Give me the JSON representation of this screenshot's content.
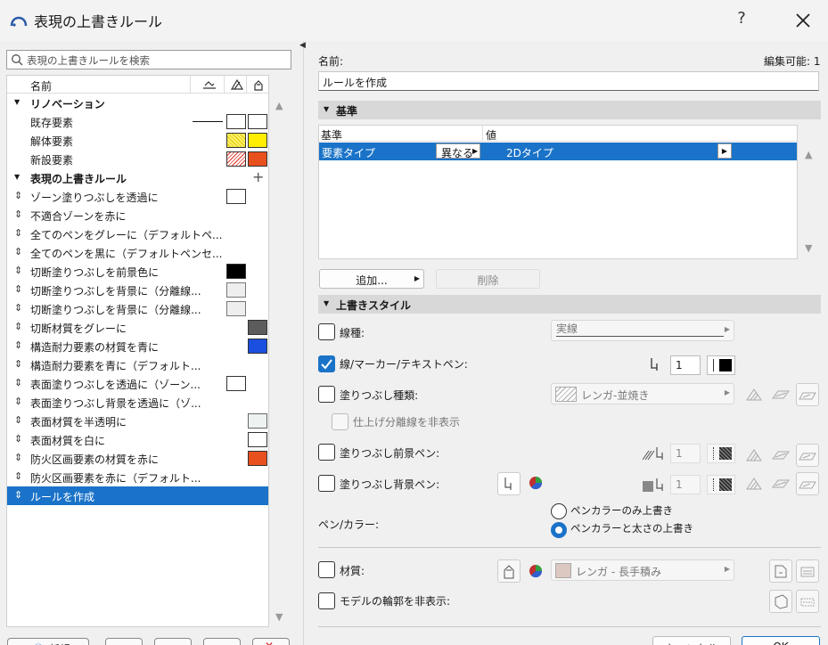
{
  "window": {
    "title": "表現の上書きルール",
    "help": "?",
    "edit_label": "編集可能: 1"
  },
  "left": {
    "search_placeholder": "表現の上書きルールを検索",
    "column_name": "名前",
    "rows": [
      {
        "kind": "group",
        "label": "リノベーション"
      },
      {
        "kind": "item",
        "label": "既存要素",
        "swatch": "line-white"
      },
      {
        "kind": "item",
        "label": "解体要素",
        "swatch": "yellow"
      },
      {
        "kind": "item",
        "label": "新設要素",
        "swatch": "red"
      },
      {
        "kind": "group",
        "label": "表現の上書きルール"
      },
      {
        "kind": "rule",
        "label": "ゾーン塗りつぶしを透過に",
        "swatch": "white-b"
      },
      {
        "kind": "rule",
        "label": "不適合ゾーンを赤に"
      },
      {
        "kind": "rule",
        "label": "全てのペンをグレーに（デフォルトペ..."
      },
      {
        "kind": "rule",
        "label": "全てのペンを黒に（デフォルトペンセ..."
      },
      {
        "kind": "rule",
        "label": "切断塗りつぶしを前景色に",
        "swatch": "black-b"
      },
      {
        "kind": "rule",
        "label": "切断塗りつぶしを背景に（分離線...",
        "swatch": "light-b"
      },
      {
        "kind": "rule",
        "label": "切断塗りつぶしを背景に（分離線...",
        "swatch": "light-b"
      },
      {
        "kind": "rule",
        "label": "切断材質をグレーに",
        "swatch": "gray-c"
      },
      {
        "kind": "rule",
        "label": "構造耐力要素の材質を青に",
        "swatch": "blue-c"
      },
      {
        "kind": "rule",
        "label": "構造耐力要素を青に（デフォルト..."
      },
      {
        "kind": "rule",
        "label": "表面塗りつぶしを透過に（ゾーン...",
        "swatch": "white-b"
      },
      {
        "kind": "rule",
        "label": "表面塗りつぶし背景を透過に（ゾ..."
      },
      {
        "kind": "rule",
        "label": "表面材質を半透明に",
        "swatch": "pale-c"
      },
      {
        "kind": "rule",
        "label": "表面材質を白に",
        "swatch": "white-c"
      },
      {
        "kind": "rule",
        "label": "防火区画要素の材質を赤に",
        "swatch": "orange-c"
      },
      {
        "kind": "rule",
        "label": "防火区画要素を赤に（デフォルト..."
      },
      {
        "kind": "rule",
        "label": "ルールを作成",
        "selected": true
      }
    ],
    "bottom_buttons": [
      "新規",
      "",
      "",
      "",
      ""
    ]
  },
  "right": {
    "name_label": "名前:",
    "name_value": "ルールを作成",
    "criteria_section": "基準",
    "crit_col1": "基準",
    "crit_col2": "値",
    "crit_row": {
      "criterion": "要素タイプ",
      "operator": "異なる",
      "value": "2Dタイプ"
    },
    "add_btn": "追加...",
    "delete_btn": "削除",
    "style_section": "上書きスタイル",
    "line_type_label": "線種:",
    "line_type_value": "実線",
    "pen_label": "線/マーカー/テキストペン:",
    "pen_value": "1",
    "fill_type_label": "塗りつぶし種類:",
    "fill_type_value": "レンガ-並焼き",
    "hide_sep_label": "仕上げ分離線を非表示",
    "fill_fg_label": "塗りつぶし前景ペン:",
    "fill_fg_value": "1",
    "fill_bg_label": "塗りつぶし背景ペン:",
    "fill_bg_value": "1",
    "pen_color_label": "ペン/カラー:",
    "radio1": "ペンカラーのみ上書き",
    "radio2": "ペンカラーと太さの上書き",
    "material_label": "材質:",
    "material_value": "レンガ - 長手積み",
    "hide_contour_label": "モデルの輪郭を非表示:",
    "cancel_btn": "キャンセル",
    "ok_btn": "OK"
  },
  "colors": {
    "accent": "#1a73c8",
    "orange": "#e8501e",
    "blue": "#1a4fe0",
    "yellow": "#ffee00"
  }
}
